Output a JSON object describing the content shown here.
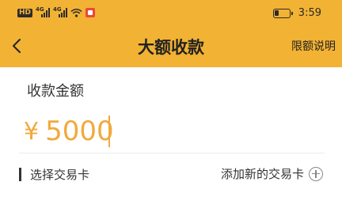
{
  "status_bar": {
    "network_badge": "HD",
    "signal_tag_1": "4G",
    "signal_tag_2": "4G",
    "time": "3:59",
    "battery_level": 0.3
  },
  "header": {
    "title": "大额收款",
    "right_link": "限额说明",
    "background_color": "#f2b233"
  },
  "amount_section": {
    "label": "收款金额",
    "currency_symbol": "¥",
    "value": "5000",
    "accent_color": "#f2a93b"
  },
  "card_section": {
    "label": "选择交易卡",
    "add_label": "添加新的交易卡"
  }
}
